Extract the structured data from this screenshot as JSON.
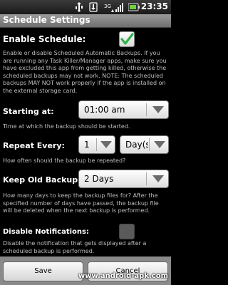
{
  "status_bar": {
    "time": "23:35",
    "icons": [
      "usb-icon",
      "download-icon",
      "network-3g-icon",
      "signal-icon",
      "battery-icon"
    ]
  },
  "window": {
    "title": "Schedule Settings"
  },
  "enable_schedule": {
    "label": "Enable Schedule:",
    "checked": true,
    "description": "Enable or disable Scheduled Automatic Backups. If you are running any Task Killer/Manager apps, make sure you have excluded this app from getting killed, otherwise the scheduled backups may not work. NOTE: The scheduled backups MAY NOT work properly if the app is installed on the external storage card."
  },
  "starting_at": {
    "label": "Starting at:",
    "value": "01:00 am",
    "description": "Time at which the backup should be started."
  },
  "repeat_every": {
    "label": "Repeat Every:",
    "number": "1",
    "unit": "Day(s",
    "description": "How often should the backup be repeated?"
  },
  "keep_old_backups": {
    "label": "Keep Old Backups:",
    "value": "2 Days",
    "description": "How many days to keep the backup files for? After the specified number of days have passed, the backup file will be deleted when the next backup is performed."
  },
  "disable_notifications": {
    "label": "Disable Notifications:",
    "checked": false,
    "description": "Disable the notification that gets displayed after a scheduled backup is performed."
  },
  "buttons": {
    "save": "Save",
    "cancel": "Cancel"
  },
  "watermark": "www.android-apk.com",
  "colors": {
    "check_green": "#2fb24a",
    "background": "#000000",
    "secondary_text": "#bdbdbd"
  }
}
